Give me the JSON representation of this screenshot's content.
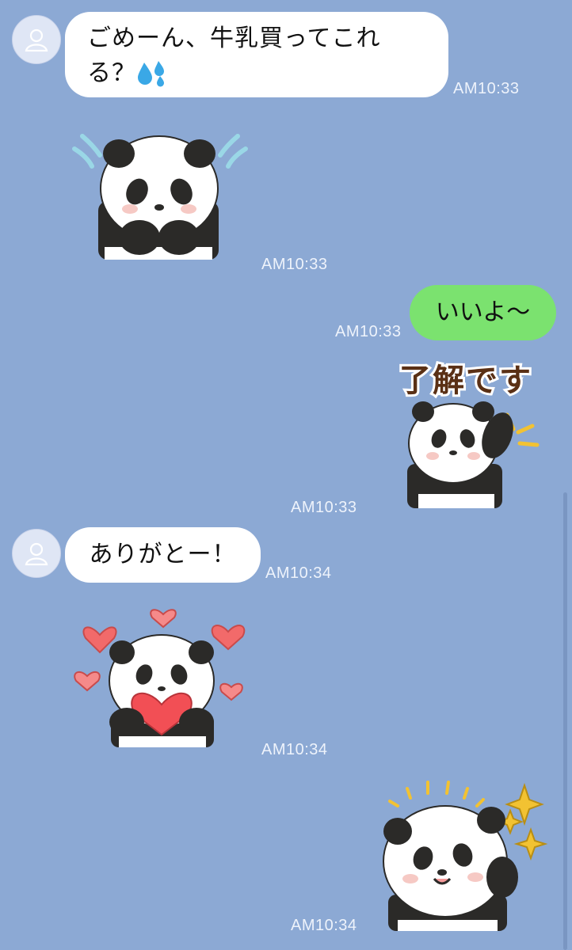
{
  "messages": [
    {
      "text_line1": "ごめーん、牛乳買ってこれ",
      "text_line2": "る？",
      "emoji": "sweat-droplets",
      "time": "AM10:33"
    },
    {
      "sticker": "panda-worried-sticker",
      "time": "AM10:33"
    },
    {
      "text": "いいよ〜",
      "time": "AM10:33"
    },
    {
      "sticker": "panda-ok-sticker",
      "caption": "了解です",
      "time": "AM10:33"
    },
    {
      "text": "ありがとー！",
      "time": "AM10:34"
    },
    {
      "sticker": "panda-heart-sticker",
      "time": "AM10:34"
    },
    {
      "sticker": "panda-sparkle-sticker",
      "time": "AM10:34"
    }
  ],
  "colors": {
    "background": "#8ca9d4",
    "incoming_bubble": "#ffffff",
    "outgoing_bubble": "#7be26f"
  }
}
